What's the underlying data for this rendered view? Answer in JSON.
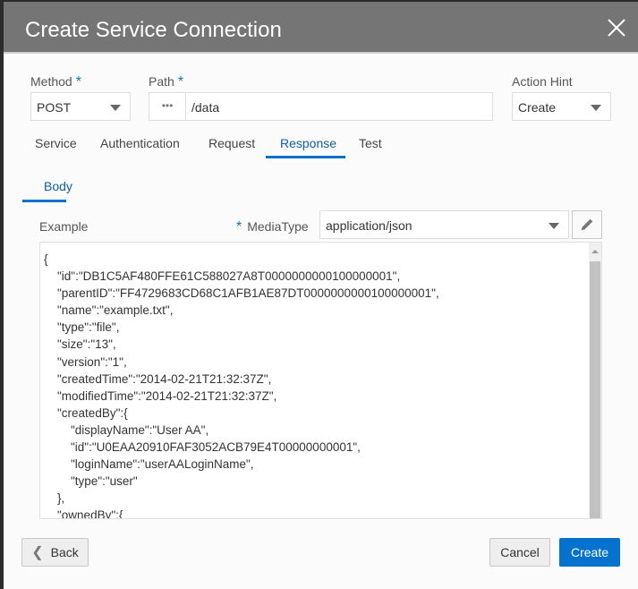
{
  "dialog": {
    "title": "Create Service Connection",
    "close_icon": "close-icon"
  },
  "form": {
    "method": {
      "label": "Method",
      "required": "*",
      "value": "POST"
    },
    "path": {
      "label": "Path",
      "required": "*",
      "value": "/data",
      "more": "•••"
    },
    "action_hint": {
      "label": "Action Hint",
      "value": "Create"
    }
  },
  "tabs": [
    {
      "label": "Service"
    },
    {
      "label": "Authentication"
    },
    {
      "label": "Request"
    },
    {
      "label": "Response",
      "active": true
    },
    {
      "label": "Test"
    }
  ],
  "subtabs": [
    {
      "label": "Body",
      "active": true
    }
  ],
  "body": {
    "example_label": "Example",
    "mediatype_required": "*",
    "mediatype_label": "MediaType",
    "mediatype_value": "application/json",
    "lines": [
      "{",
      "    \"id\":\"DB1C5AF480FFE61C588027A8T0000000000100000001\",",
      "    \"parentID\":\"FF4729683CD68C1AFB1AE87DT0000000000100000001\",",
      "    \"name\":\"example.txt\",",
      "    \"type\":\"file\",",
      "    \"size\":\"13\",",
      "    \"version\":\"1\",",
      "    \"createdTime\":\"2014-02-21T21:32:37Z\",",
      "    \"modifiedTime\":\"2014-02-21T21:32:37Z\",",
      "    \"createdBy\":{",
      "        \"displayName\":\"User AA\",",
      "        \"id\":\"U0EAA20910FAF3052ACB79E4T00000000001\",",
      "        \"loginName\":\"userAALoginName\",",
      "        \"type\":\"user\"",
      "    },",
      "    \"ownedBy\":{"
    ]
  },
  "footer": {
    "back": "Back",
    "cancel": "Cancel",
    "create": "Create"
  },
  "colors": {
    "accent": "#0572ce",
    "header": "#757575"
  }
}
